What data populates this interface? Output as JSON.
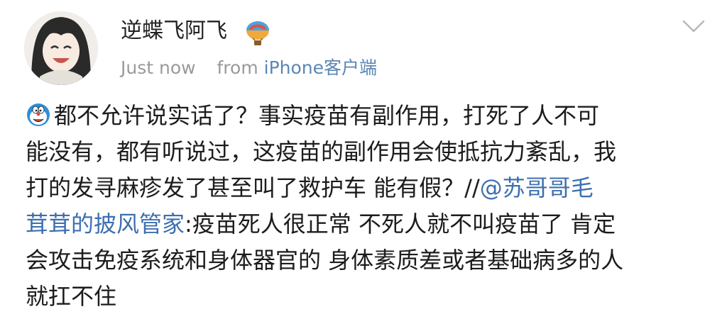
{
  "user": {
    "name": "逆蝶飞阿飞",
    "timestamp": "Just now",
    "from_label": "from",
    "source": "iPhone客户端"
  },
  "post": {
    "emoji_icon": "doraemon-emoji-icon",
    "lines": [
      "都不允许说实话了？事实疫苗有副作用，打死了人不可",
      "能没有，都有听说过，这疫苗的副作用会使抵抗力紊乱，我",
      "打的发寻麻疹发了甚至叫了救护车 能有假？//"
    ],
    "mention_part1": "@苏哥哥毛",
    "mention_part2": "茸茸的披风管家",
    "after_mention": ":疫苗死人很正常 不死人就不叫疫苗了 肯定",
    "line5": "会攻击免疫系统和身体器官的 身体素质差或者基础病多的人",
    "line6": "就扛不住"
  },
  "colors": {
    "link": "#3d6fb0",
    "meta": "#9a9a9a",
    "source": "#5b86b5"
  }
}
